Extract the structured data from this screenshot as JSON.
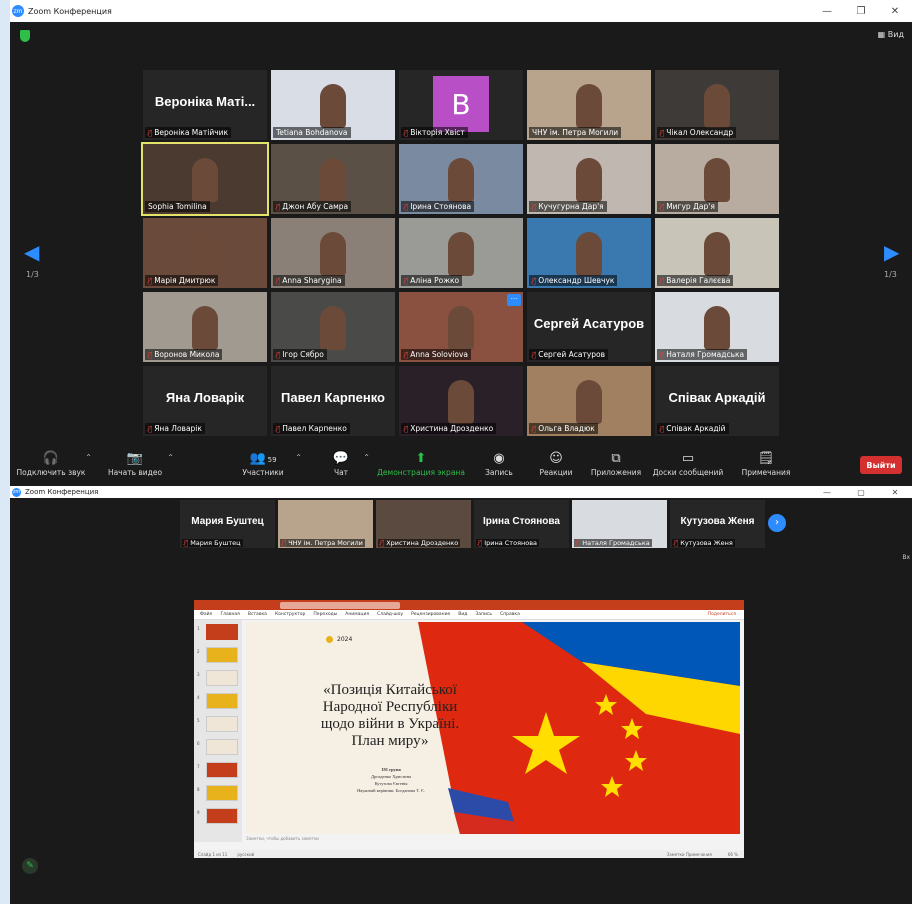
{
  "window1": {
    "title": "Zoom Конференция",
    "view_label": "Вид",
    "page_indicator_left": "1/3",
    "page_indicator_right": "1/3",
    "tiles": [
      {
        "big": "Вероніка Маті...",
        "name": "Вероніка Матійчик",
        "muted": true,
        "type": "name"
      },
      {
        "big": "",
        "name": "Tetiana Bohdanova",
        "muted": false,
        "type": "video",
        "bg": "#d8dde6"
      },
      {
        "big": "B",
        "name": "Вікторія Хвіст",
        "muted": true,
        "type": "avatar"
      },
      {
        "big": "",
        "name": "ЧНУ ім. Петра Могили",
        "muted": false,
        "type": "video",
        "bg": "#b8a48c"
      },
      {
        "big": "",
        "name": "Чікал Олександр",
        "muted": true,
        "type": "video",
        "bg": "#3e3a38"
      },
      {
        "big": "",
        "name": "Sophia Tomilina",
        "muted": false,
        "type": "video",
        "bg": "#4a3a30",
        "active": true
      },
      {
        "big": "",
        "name": "Джон Абу Самра",
        "muted": true,
        "type": "video",
        "bg": "#5a5046"
      },
      {
        "big": "",
        "name": "Ірина Стоянова",
        "muted": true,
        "type": "video",
        "bg": "#7a8aa0"
      },
      {
        "big": "",
        "name": "Кучугурна Дар'я",
        "muted": true,
        "type": "video",
        "bg": "#c0b8b0"
      },
      {
        "big": "",
        "name": "Мигур Дар'я",
        "muted": true,
        "type": "video",
        "bg": "#b8aca0"
      },
      {
        "big": "",
        "name": "Марія Дмитрюк",
        "muted": true,
        "type": "video",
        "bg": "#6a4a3a"
      },
      {
        "big": "",
        "name": "Anna Sharygina",
        "muted": true,
        "type": "video",
        "bg": "#8a8078"
      },
      {
        "big": "",
        "name": "Аліна Рожко",
        "muted": true,
        "type": "video",
        "bg": "#9a9a96"
      },
      {
        "big": "",
        "name": "Олександр Шевчук",
        "muted": true,
        "type": "video",
        "bg": "#3a78b0"
      },
      {
        "big": "",
        "name": "Валерія Галєєва",
        "muted": true,
        "type": "video",
        "bg": "#c8c4b8"
      },
      {
        "big": "",
        "name": "Воронов Микола",
        "muted": true,
        "type": "video",
        "bg": "#a09a90"
      },
      {
        "big": "",
        "name": "Ігор Сябро",
        "muted": true,
        "type": "video",
        "bg": "#4a4a48"
      },
      {
        "big": "",
        "name": "Anna Soloviova",
        "muted": true,
        "type": "video",
        "bg": "#8a5040",
        "more": true
      },
      {
        "big": "Сергей Асатуров",
        "name": "Сергей Асатуров",
        "muted": true,
        "type": "name"
      },
      {
        "big": "",
        "name": "Наталя Громадська",
        "muted": true,
        "type": "video",
        "bg": "#d8dce0"
      },
      {
        "big": "Яна Ловарік",
        "name": "Яна Ловарік",
        "muted": true,
        "type": "name"
      },
      {
        "big": "Павел Карпенко",
        "name": "Павел Карпенко",
        "muted": true,
        "type": "name"
      },
      {
        "big": "",
        "name": "Христина Дрозденко",
        "muted": true,
        "type": "video",
        "bg": "#2a2028"
      },
      {
        "big": "",
        "name": "Ольга Владюк",
        "muted": true,
        "type": "video",
        "bg": "#a08060"
      },
      {
        "big": "Співак Аркадій",
        "name": "Співак Аркадій",
        "muted": true,
        "type": "name"
      }
    ],
    "toolbar": {
      "audio": "Подключить звук",
      "video": "Начать видео",
      "participants": "Участники",
      "participants_count": "59",
      "chat": "Чат",
      "share": "Демонстрация экрана",
      "record": "Запись",
      "reactions": "Реакции",
      "apps": "Приложения",
      "whiteboard": "Доски сообщений",
      "notes": "Примечания",
      "leave": "Выйти"
    }
  },
  "window2": {
    "title": "Zoom Конференция",
    "side_label": "Вх",
    "strip": [
      {
        "big": "Мария Буштец",
        "name": "Мария Буштец",
        "type": "name"
      },
      {
        "big": "",
        "name": "ЧНУ ім. Петра Могили",
        "type": "video",
        "bg": "#b8a48c"
      },
      {
        "big": "",
        "name": "Христина Дрозденко",
        "type": "video",
        "bg": "#5a4a40"
      },
      {
        "big": "Ірина Стоянова",
        "name": "Ірина Стоянова",
        "type": "name"
      },
      {
        "big": "",
        "name": "Наталя Громадська",
        "type": "video",
        "bg": "#d8dce0"
      },
      {
        "big": "Кутузова Женя",
        "name": "Кутузова Женя",
        "type": "name"
      }
    ],
    "ppt": {
      "tabs": [
        "Файл",
        "Главная",
        "Вставка",
        "Конструктор",
        "Переходы",
        "Анимация",
        "Слайд-шоу",
        "Рецензирование",
        "Вид",
        "Запись",
        "Справка"
      ],
      "share_label": "Поделиться",
      "notes_placeholder": "Заметки, чтобы добавить заметки",
      "slide": {
        "year": "2024",
        "title": "«Позиція Китайської Народної Республіки щодо війни в Україні. План миру»",
        "info": [
          "191 група",
          "Дрозденко Христина",
          "Кутузова Євгенія",
          "Науковий керівник: Богданова Т. Є."
        ]
      },
      "status_left": "Слайд 1 из 11",
      "status_lang": "русский",
      "status_right": "Заметки   Примечания",
      "zoom_level": "66 %",
      "colors": {
        "ppt_red": "#c43e1c",
        "china_red": "#de2910",
        "china_yellow": "#ffde00",
        "ukr_blue": "#0057b7",
        "ukr_yellow": "#ffd700"
      }
    }
  }
}
